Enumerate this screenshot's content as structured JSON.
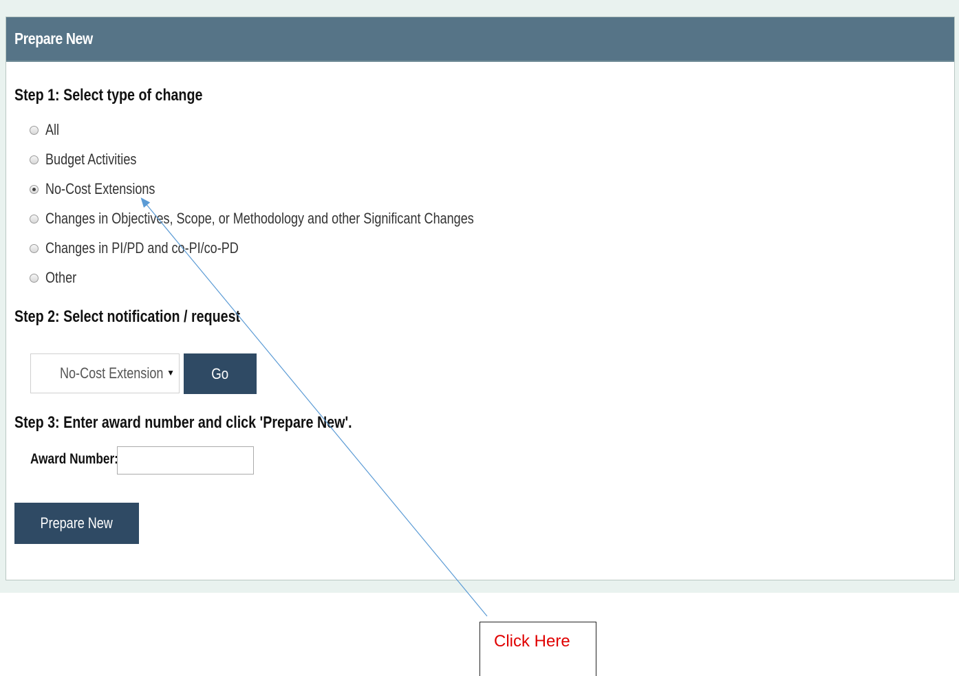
{
  "panel": {
    "title": "Prepare New"
  },
  "step1": {
    "heading": "Step 1: Select type of change",
    "options": [
      {
        "label": "All",
        "checked": false
      },
      {
        "label": "Budget Activities",
        "checked": false
      },
      {
        "label": "No-Cost Extensions",
        "checked": true
      },
      {
        "label": "Changes in Objectives, Scope, or Methodology and other Significant Changes",
        "checked": false
      },
      {
        "label": "Changes in PI/PD and co-PI/co-PD",
        "checked": false
      },
      {
        "label": "Other",
        "checked": false
      }
    ]
  },
  "step2": {
    "heading": "Step 2: Select notification / request",
    "select_value": "No-Cost Extension",
    "go_label": "Go"
  },
  "step3": {
    "heading": "Step 3: Enter award number and click 'Prepare New'.",
    "award_label": "Award Number:",
    "award_value": "",
    "prepare_label": "Prepare New"
  },
  "callout": {
    "text": "Click Here"
  },
  "colors": {
    "header_bg": "#567487",
    "button_bg": "#2f4a64",
    "callout_text": "#e00000",
    "arrow": "#5b9bd5"
  }
}
